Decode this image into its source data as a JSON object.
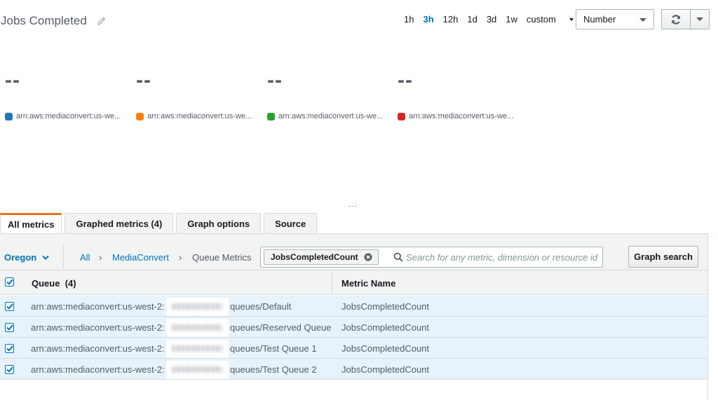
{
  "header": {
    "title": "Jobs Completed",
    "time_ranges": [
      "1h",
      "3h",
      "12h",
      "1d",
      "3d",
      "1w"
    ],
    "active_range": "3h",
    "custom_label": "custom",
    "stat_select": "Number"
  },
  "metrics": [
    {
      "value": "--",
      "label": "arn:aws:mediaconvert:us-we...",
      "color": "#1f77b4"
    },
    {
      "value": "--",
      "label": "arn:aws:mediaconvert:us-we...",
      "color": "#ff7f0e"
    },
    {
      "value": "--",
      "label": "arn:aws:mediaconvert:us-we...",
      "color": "#2ca02c"
    },
    {
      "value": "--",
      "label": "arn:aws:mediaconvert:us-we...",
      "color": "#d62728"
    }
  ],
  "tabs": [
    {
      "label": "All metrics",
      "active": true
    },
    {
      "label": "Graphed metrics (4)",
      "active": false
    },
    {
      "label": "Graph options",
      "active": false
    },
    {
      "label": "Source",
      "active": false
    }
  ],
  "filter": {
    "region": "Oregon",
    "breadcrumbs": [
      "All",
      "MediaConvert",
      "Queue Metrics"
    ],
    "token": "JobsCompletedCount",
    "search_placeholder": "Search for any metric, dimension or resource id",
    "graph_search": "Graph search"
  },
  "table": {
    "columns": {
      "queue": "Queue",
      "queue_count": "(4)",
      "metric": "Metric Name"
    },
    "rows": [
      {
        "arn_prefix": "arn:aws:mediaconvert:us-west-2:",
        "queue_suffix": "queues/Default",
        "metric": "JobsCompletedCount",
        "checked": true
      },
      {
        "arn_prefix": "arn:aws:mediaconvert:us-west-2:",
        "queue_suffix": "queues/Reserved Queue",
        "metric": "JobsCompletedCount",
        "checked": true
      },
      {
        "arn_prefix": "arn:aws:mediaconvert:us-west-2:",
        "queue_suffix": "queues/Test Queue 1",
        "metric": "JobsCompletedCount",
        "checked": true
      },
      {
        "arn_prefix": "arn:aws:mediaconvert:us-west-2:",
        "queue_suffix": "queues/Test Queue 2",
        "metric": "JobsCompletedCount",
        "checked": true
      }
    ]
  },
  "colors": {
    "accent": "#0073bb",
    "tab_active": "#ec7211",
    "row_selected": "#e7f3fc"
  }
}
